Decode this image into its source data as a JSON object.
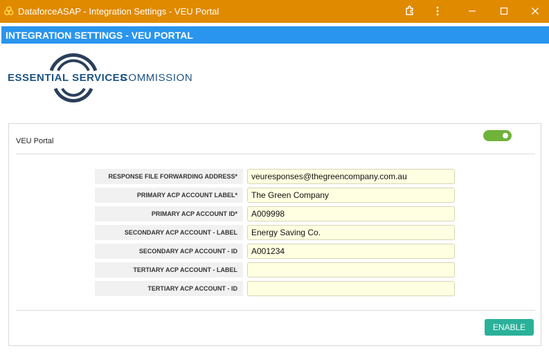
{
  "window": {
    "title": "DataforceASAP - Integration Settings - VEU Portal"
  },
  "header": {
    "title": "INTEGRATION SETTINGS - VEU PORTAL"
  },
  "logo": {
    "text_bold": "ESSENTIAL SERVICES",
    "text_light": "COMMISSION"
  },
  "panel": {
    "section_label": "VEU Portal",
    "toggle_state": "on",
    "fields": [
      {
        "label": "RESPONSE FILE FORWARDING ADDRESS*",
        "value": "veuresponses@thegreencompany.com.au"
      },
      {
        "label": "PRIMARY ACP ACCOUNT LABEL*",
        "value": "The Green Company"
      },
      {
        "label": "PRIMARY ACP ACCOUNT ID*",
        "value": "A009998"
      },
      {
        "label": "SECONDARY ACP ACCOUNT - LABEL",
        "value": "Energy Saving Co."
      },
      {
        "label": "SECONDARY ACP ACCOUNT - ID",
        "value": "A001234"
      },
      {
        "label": "TERTIARY ACP ACCOUNT - LABEL",
        "value": ""
      },
      {
        "label": "TERTIARY ACP ACCOUNT - ID",
        "value": ""
      }
    ],
    "enable_label": "ENABLE"
  },
  "colors": {
    "titlebar": "#e08a00",
    "header": "#2a95ee",
    "toggle_on": "#6fb33a",
    "enable_button": "#2ab19a",
    "input_bg": "#ffffe1",
    "logo_blue": "#1d5383"
  },
  "icons": [
    "app-icon",
    "extensions-icon",
    "more-options-icon",
    "minimize-icon",
    "maximize-icon",
    "close-icon"
  ]
}
